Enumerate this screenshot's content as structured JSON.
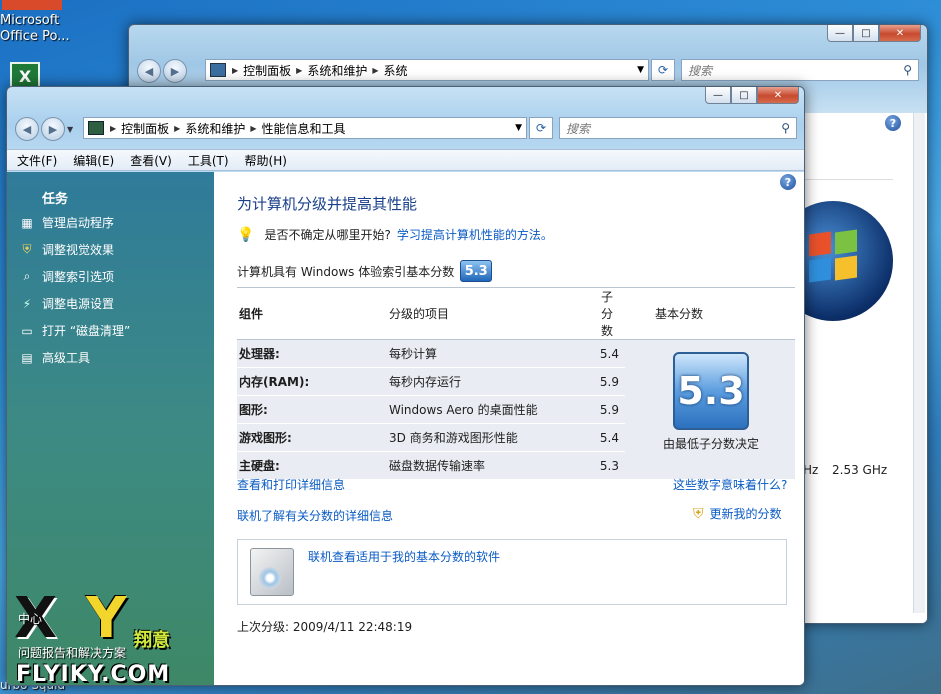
{
  "desktop": {
    "office_icon_label_1": "Microsoft",
    "office_icon_label_2": "Office Po...",
    "watermark": "FLYIKY.COM",
    "watermark_cn": "翔意",
    "bottom_left_text": "urbo Squid",
    "behind_text_1": "中心",
    "behind_text_2": "问题报告和解决方案"
  },
  "back_window": {
    "address": [
      "控制面板",
      "系统和维护",
      "系统"
    ],
    "search_placeholder": "搜索",
    "cpu_text_1": "Hz",
    "cpu_text_2": "2.53 GHz"
  },
  "front_window": {
    "address": [
      "控制面板",
      "系统和维护",
      "性能信息和工具"
    ],
    "search_placeholder": "搜索",
    "menu": [
      "文件(F)",
      "编辑(E)",
      "查看(V)",
      "工具(T)",
      "帮助(H)"
    ],
    "sidebar": {
      "title": "任务",
      "tasks": [
        "管理启动程序",
        "调整视觉效果",
        "调整索引选项",
        "调整电源设置",
        "打开 “磁盘清理”",
        "高级工具"
      ]
    },
    "main": {
      "heading": "为计算机分级并提高其性能",
      "tip_text": "是否不确定从哪里开始?",
      "tip_link": "学习提高计算机性能的方法。",
      "score_line": "计算机具有 Windows 体验索引基本分数",
      "base_score": "5.3",
      "table": {
        "headers": [
          "组件",
          "分级的项目",
          "子分数",
          "基本分数"
        ],
        "rows": [
          {
            "component": "处理器:",
            "item": "每秒计算",
            "score": "5.4"
          },
          {
            "component": "内存(RAM):",
            "item": "每秒内存运行",
            "score": "5.9"
          },
          {
            "component": "图形:",
            "item": "Windows Aero 的桌面性能",
            "score": "5.9"
          },
          {
            "component": "游戏图形:",
            "item": "3D 商务和游戏图形性能",
            "score": "5.4"
          },
          {
            "component": "主硬盘:",
            "item": "磁盘数据传输速率",
            "score": "5.3"
          }
        ],
        "base_caption": "由最低子分数决定"
      },
      "link_print": "查看和打印详细信息",
      "link_meaning": "这些数字意味着什么?",
      "link_online": "联机了解有关分数的详细信息",
      "link_update": "更新我的分数",
      "link_software": "联机查看适用于我的基本分数的软件",
      "last_rating": "上次分级: 2009/4/11 22:48:19"
    }
  }
}
